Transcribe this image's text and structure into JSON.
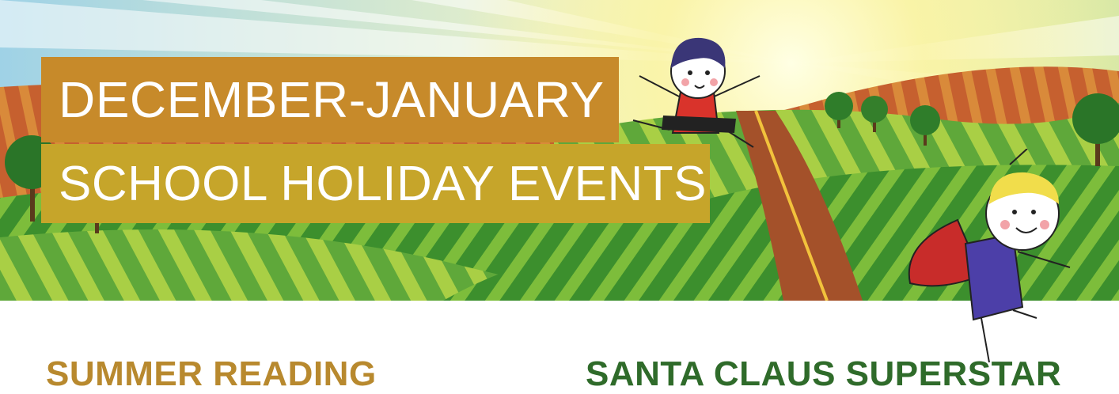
{
  "banner": {
    "title_line_1": "DECEMBER-JANUARY",
    "title_line_2": "SCHOOL HOLIDAY EVENTS",
    "colors": {
      "title_box_1": "#c78a2a",
      "title_box_2": "#c6a52a",
      "sky": "#f6f3b4",
      "field_green": "#3f9a2e",
      "field_brown": "#a4512a"
    },
    "illustration": [
      "rolling-fields",
      "sun-rays",
      "trees",
      "road"
    ]
  },
  "characters": [
    "jumping-kid",
    "caped-kid"
  ],
  "sections": {
    "summer_reading": {
      "label": "SUMMER READING",
      "color": "#b8892e"
    },
    "santa": {
      "label": "SANTA CLAUS SUPERSTAR",
      "color": "#2f6b2a"
    }
  }
}
